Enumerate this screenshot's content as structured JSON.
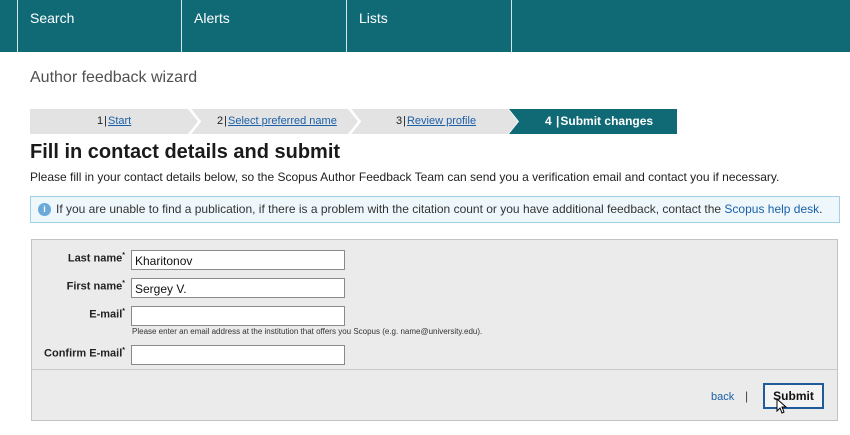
{
  "nav": {
    "search": "Search",
    "alerts": "Alerts",
    "lists": "Lists"
  },
  "wizard_title": "Author feedback wizard",
  "steps": [
    {
      "number": "1",
      "label": "Start",
      "state": "link"
    },
    {
      "number": "2",
      "label": "Select preferred name",
      "state": "link"
    },
    {
      "number": "3",
      "label": "Review profile",
      "state": "link"
    },
    {
      "number": "4",
      "label": "Submit changes",
      "state": "current"
    }
  ],
  "heading": "Fill in contact details and submit",
  "description": "Please fill in your contact details below, so the Scopus Author Feedback Team can send you a verification email and contact you if necessary.",
  "info": {
    "icon": "info-icon",
    "text": "If you are unable to find a publication, if there is a problem with the citation count or you have additional feedback, contact the ",
    "link": "Scopus help desk",
    "suffix": "."
  },
  "form": {
    "last_name": {
      "label": "Last name",
      "value": "Kharitonov"
    },
    "first_name": {
      "label": "First name",
      "value": "Sergey V."
    },
    "email": {
      "label": "E-mail",
      "value": "",
      "hint": "Please enter an email address at the institution that offers you Scopus (e.g. name@university.edu)."
    },
    "confirm_email": {
      "label": "Confirm E-mail",
      "value": ""
    },
    "required_mark": "*"
  },
  "footer": {
    "back": "back",
    "divider": "|",
    "submit": "Submit"
  },
  "colors": {
    "nav_bg": "#106a76",
    "step_inactive": "#e3e3e3",
    "step_active": "#106a76",
    "link": "#1a5fa8",
    "info_bg": "#eef8fc"
  }
}
